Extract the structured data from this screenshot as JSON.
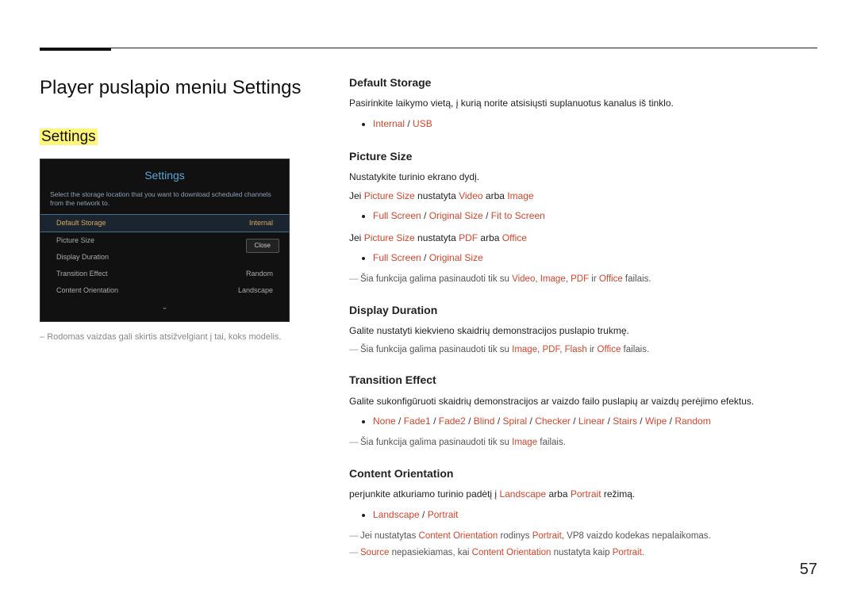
{
  "page_title": "Player puslapio meniu Settings",
  "section_heading": "Settings",
  "page_number": "57",
  "mock": {
    "title": "Settings",
    "desc": "Select the storage location that you want to download scheduled channels from the network to.",
    "rows": [
      {
        "label": "Default Storage",
        "value": "Internal",
        "selected": true
      },
      {
        "label": "Picture Size",
        "value": ""
      },
      {
        "label": "Display Duration",
        "value": ""
      },
      {
        "label": "Transition Effect",
        "value": "Random"
      },
      {
        "label": "Content Orientation",
        "value": "Landscape"
      }
    ],
    "close": "Close"
  },
  "caption_prefix": "– ",
  "caption": "Rodomas vaizdas gali skirtis atsižvelgiant į tai, koks modelis.",
  "sections": {
    "default_storage": {
      "h": "Default Storage",
      "p1": "Pasirinkite laikymo vietą, į kurią norite atsisiųsti suplanuotus kanalus iš tinklo.",
      "opt_internal": "Internal",
      "opt_usb": "USB"
    },
    "picture_size": {
      "h": "Picture Size",
      "p1": "Nustatykite turinio ekrano dydį.",
      "jei1_pre": "Jei ",
      "jei1_kw1": "Picture Size",
      "jei1_mid1": " nustatyta ",
      "jei1_kw2": "Video",
      "jei1_or": " arba ",
      "jei1_kw3": "Image",
      "li1_full": "Full Screen",
      "li1_orig": "Original Size",
      "li1_fit": "Fit to Screen",
      "jei2_kw2": "PDF",
      "jei2_kw3": "Office",
      "li2_full": "Full Screen",
      "li2_orig": "Original Size",
      "note_pre": "Šia funkcija galima pasinaudoti tik su ",
      "note_v": "Video",
      "note_sep": ", ",
      "note_i": "Image",
      "note_p": "PDF",
      "note_ir": " ir ",
      "note_o": "Office",
      "note_suf": " failais."
    },
    "display_duration": {
      "h": "Display Duration",
      "p1": "Galite nustatyti kiekvieno skaidrių demonstracijos puslapio trukmę.",
      "note_pre": "Šia funkcija galima pasinaudoti tik su ",
      "note_i": "Image",
      "note_sep": ", ",
      "note_p": "PDF",
      "note_f": "Flash",
      "note_ir": " ir ",
      "note_o": "Office",
      "note_suf": " failais."
    },
    "transition": {
      "h": "Transition Effect",
      "p1": "Galite sukonfigūruoti skaidrių demonstracijos ar vaizdo failo puslapių ar vaizdų perėjimo efektus.",
      "none": "None",
      "f1": "Fade1",
      "f2": "Fade2",
      "blind": "Blind",
      "spiral": "Spiral",
      "checker": "Checker",
      "linear": "Linear",
      "stairs": "Stairs",
      "wipe": "Wipe",
      "random": "Random",
      "note_pre": "Šia funkcija galima pasinaudoti tik su ",
      "note_i": "Image",
      "note_suf": " failais."
    },
    "orientation": {
      "h": "Content Orientation",
      "p1_pre": "perjunkite atkuriamo turinio padėtį į ",
      "land": "Landscape",
      "or": " arba ",
      "port": "Portrait",
      "p1_suf": " režimą.",
      "n1_pre": "Jei nustatytas ",
      "n1_co": "Content Orientation",
      "n1_mid": " rodinys ",
      "n1_port": "Portrait",
      "n1_suf": ", VP8 vaizdo kodekas nepalaikomas.",
      "n2_src": "Source",
      "n2_mid1": " nepasiekiamas, kai ",
      "n2_co": "Content Orientation",
      "n2_mid2": " nustatyta kaip ",
      "n2_port": "Portrait",
      "n2_dot": "."
    }
  }
}
